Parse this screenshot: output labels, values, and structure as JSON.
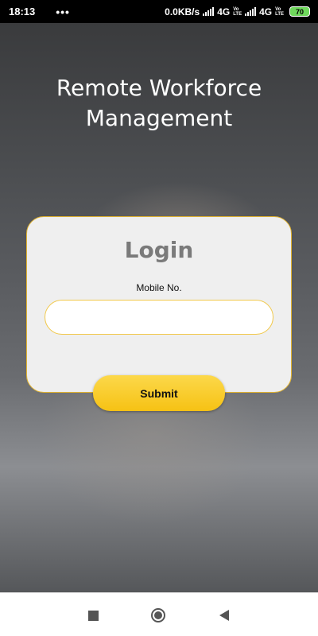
{
  "status_bar": {
    "time": "18:13",
    "dots": "•••",
    "network_speed": "0.0KB/s",
    "sim1_network": "4G",
    "sim2_network": "4G",
    "volte_top": "Vo",
    "volte_bottom": "LTE",
    "battery": "70",
    "battery_color": "#6fd85c"
  },
  "app": {
    "title_line1": "Remote Workforce",
    "title_line2": "Management"
  },
  "login": {
    "heading": "Login",
    "mobile_label": "Mobile No.",
    "mobile_value": "",
    "mobile_placeholder": "",
    "submit_label": "Submit"
  },
  "colors": {
    "accent": "#f6c214",
    "card_border": "#e4b530",
    "card_bg": "#efefef"
  },
  "nav_bar": {
    "icons": [
      "recents-square-icon",
      "home-circle-icon",
      "back-triangle-icon"
    ]
  }
}
